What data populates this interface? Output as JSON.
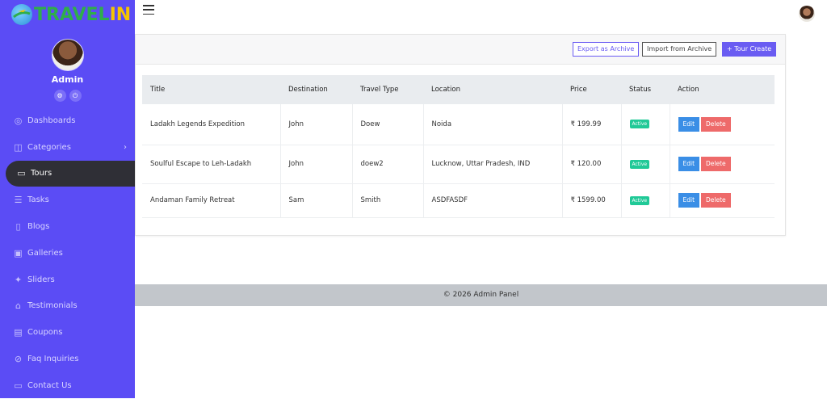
{
  "brand": {
    "text_green": "TRAVEL",
    "text_yellow": "IN",
    "logo_icon": "globe-plane-icon"
  },
  "profile": {
    "name": "Admin",
    "icons": [
      "settings-icon",
      "power-icon"
    ]
  },
  "menu": [
    {
      "label": "Dashboards",
      "icon": "dashboard-icon"
    },
    {
      "label": "Categories",
      "icon": "categories-icon",
      "chevron": "›"
    },
    {
      "label": "Tours",
      "icon": "tours-icon",
      "active": true
    },
    {
      "label": "Tasks",
      "icon": "tasks-icon"
    },
    {
      "label": "Blogs",
      "icon": "blogs-icon"
    },
    {
      "label": "Galleries",
      "icon": "galleries-icon"
    },
    {
      "label": "Sliders",
      "icon": "sliders-icon"
    },
    {
      "label": "Testimonials",
      "icon": "testimonials-icon"
    },
    {
      "label": "Coupons",
      "icon": "coupons-icon"
    },
    {
      "label": "Faq Inquiries",
      "icon": "faq-icon"
    },
    {
      "label": "Contact Us",
      "icon": "contact-icon"
    }
  ],
  "toolbar": {
    "export_label": "Export as Archive",
    "import_label": "Import from Archive",
    "create_label": "+ Tour Create"
  },
  "table": {
    "headers": [
      "Title",
      "Destination",
      "Travel Type",
      "Location",
      "Price",
      "Status",
      "Action"
    ],
    "rows": [
      {
        "title": "Ladakh Legends Expedition",
        "destination": "John",
        "travel_type": "Doew",
        "location": "Noida",
        "price": "₹ 199.99",
        "status": "Active"
      },
      {
        "title": "Soulful Escape to Leh-Ladakh",
        "destination": "John",
        "travel_type": "doew2",
        "location": "Lucknow, Uttar Pradesh, IND",
        "price": "₹ 120.00",
        "status": "Active"
      },
      {
        "title": "Andaman Family Retreat",
        "destination": "Sam",
        "travel_type": "Smith",
        "location": "ASDFASDF",
        "price": "₹ 1599.00",
        "status": "Active"
      }
    ],
    "edit_label": "Edit",
    "delete_label": "Delete"
  },
  "footer": {
    "text": "© 2026 Admin Panel"
  },
  "colors": {
    "sidebar": "#5b4cf5",
    "active_item": "#2f2f36",
    "accent": "#6a5cf2",
    "edit": "#3a8ee6",
    "delete": "#ee6a6a",
    "badge": "#20c997"
  }
}
